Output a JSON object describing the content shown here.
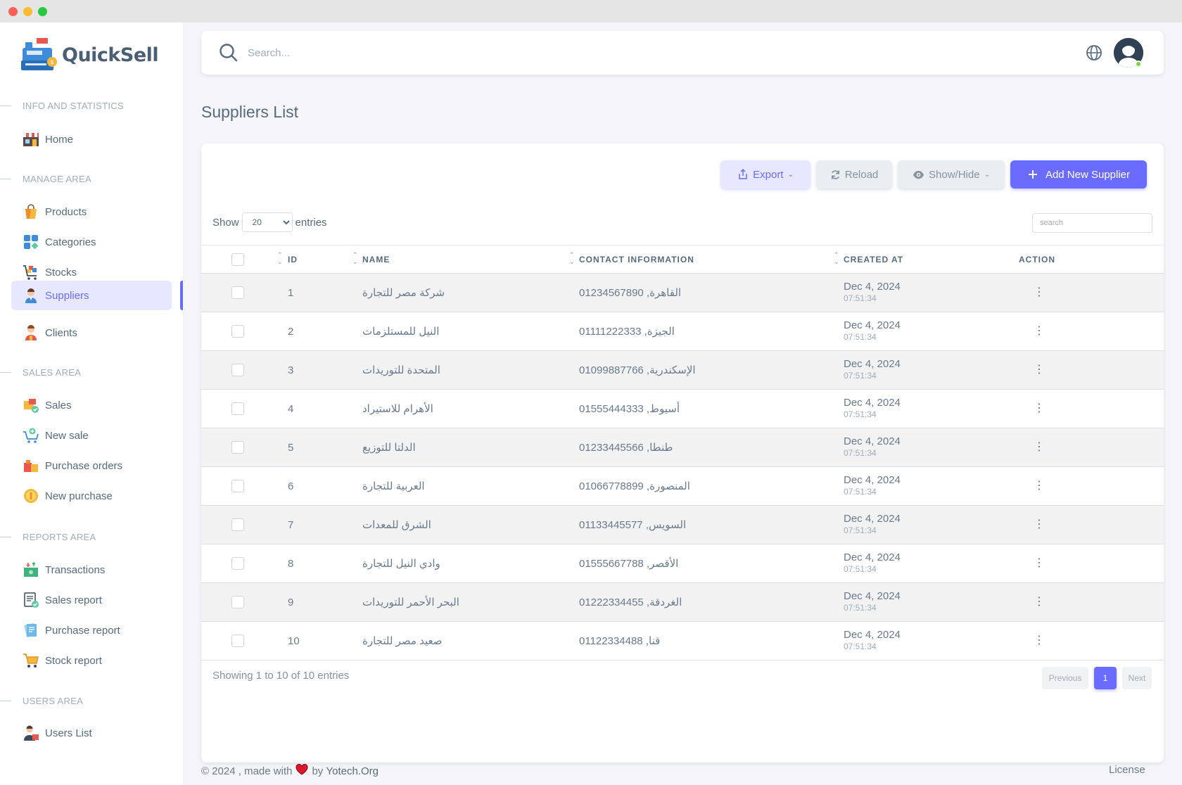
{
  "app": {
    "brand_name": "QuickSell"
  },
  "navbar": {
    "search_placeholder": "Search..."
  },
  "sidebar": {
    "sections": [
      {
        "header": "INFO AND STATISTICS",
        "items": [
          {
            "label": "Home",
            "icon": "store-icon"
          }
        ]
      },
      {
        "header": "MANAGE AREA",
        "items": [
          {
            "label": "Products",
            "icon": "shopping-bag-icon"
          },
          {
            "label": "Categories",
            "icon": "categories-icon"
          },
          {
            "label": "Stocks",
            "icon": "cart-boxes-icon"
          },
          {
            "label": "Suppliers",
            "icon": "supplier-person-icon",
            "active": true
          },
          {
            "label": "Clients",
            "icon": "client-person-icon"
          }
        ]
      },
      {
        "header": "SALES AREA",
        "items": [
          {
            "label": "Sales",
            "icon": "sales-boxes-icon"
          },
          {
            "label": "New sale",
            "icon": "add-cart-icon"
          },
          {
            "label": "Purchase orders",
            "icon": "purchase-orders-icon"
          },
          {
            "label": "New purchase",
            "icon": "coin-icon"
          }
        ]
      },
      {
        "header": "REPORTS AREA",
        "items": [
          {
            "label": "Transactions",
            "icon": "transactions-icon"
          },
          {
            "label": "Sales report",
            "icon": "invoice-check-icon"
          },
          {
            "label": "Purchase report",
            "icon": "receipt-icon"
          },
          {
            "label": "Stock report",
            "icon": "cart-icon"
          }
        ]
      },
      {
        "header": "USERS AREA",
        "items": [
          {
            "label": "Users List",
            "icon": "users-icon"
          }
        ]
      }
    ]
  },
  "page": {
    "title": "Suppliers List"
  },
  "toolbar": {
    "export_label": "Export",
    "reload_label": "Reload",
    "showhide_label": "Show/Hide",
    "add_label": "Add New Supplier"
  },
  "table_controls": {
    "show_label": "Show",
    "entries_value": "20",
    "entries_label": "entries",
    "search_placeholder": "search"
  },
  "table": {
    "columns": [
      "ID",
      "NAME",
      "CONTACT INFORMATION",
      "CREATED AT",
      "ACTION"
    ],
    "rows": [
      {
        "id": "1",
        "name": "شركة مصر للتجارة",
        "contact": "01234567890 ,القاهرة",
        "date": "Dec 4, 2024",
        "time": "07:51:34"
      },
      {
        "id": "2",
        "name": "النيل للمستلزمات",
        "contact": "01111222333 ,الجيزة",
        "date": "Dec 4, 2024",
        "time": "07:51:34"
      },
      {
        "id": "3",
        "name": "المتحدة للتوريدات",
        "contact": "01099887766 ,الإسكندرية",
        "date": "Dec 4, 2024",
        "time": "07:51:34"
      },
      {
        "id": "4",
        "name": "الأهرام للاستيراد",
        "contact": "01555444333 ,أسيوط",
        "date": "Dec 4, 2024",
        "time": "07:51:34"
      },
      {
        "id": "5",
        "name": "الدلتا للتوزيع",
        "contact": "01233445566 ,طنطا",
        "date": "Dec 4, 2024",
        "time": "07:51:34"
      },
      {
        "id": "6",
        "name": "العربية للتجارة",
        "contact": "01066778899 ,المنصورة",
        "date": "Dec 4, 2024",
        "time": "07:51:34"
      },
      {
        "id": "7",
        "name": "الشرق للمعدات",
        "contact": "01133445577 ,السويس",
        "date": "Dec 4, 2024",
        "time": "07:51:34"
      },
      {
        "id": "8",
        "name": "وادي النيل للتجارة",
        "contact": "01555667788 ,الأقصر",
        "date": "Dec 4, 2024",
        "time": "07:51:34"
      },
      {
        "id": "9",
        "name": "البحر الأحمر للتوريدات",
        "contact": "01222334455 ,الغردقة",
        "date": "Dec 4, 2024",
        "time": "07:51:34"
      },
      {
        "id": "10",
        "name": "صعيد مصر للتجارة",
        "contact": "01122334488 ,قنا",
        "date": "Dec 4, 2024",
        "time": "07:51:34"
      }
    ]
  },
  "pagination": {
    "info": "Showing 1 to 10 of 10 entries",
    "previous": "Previous",
    "current": "1",
    "next": "Next"
  },
  "footer": {
    "copyright": "© 2024 , made with",
    "by": "by",
    "author": "Yotech.Org",
    "license": "License"
  },
  "colors": {
    "accent": "#696cff",
    "text": "#566a7f",
    "muted": "#a1acb8",
    "online": "#71dd37"
  }
}
